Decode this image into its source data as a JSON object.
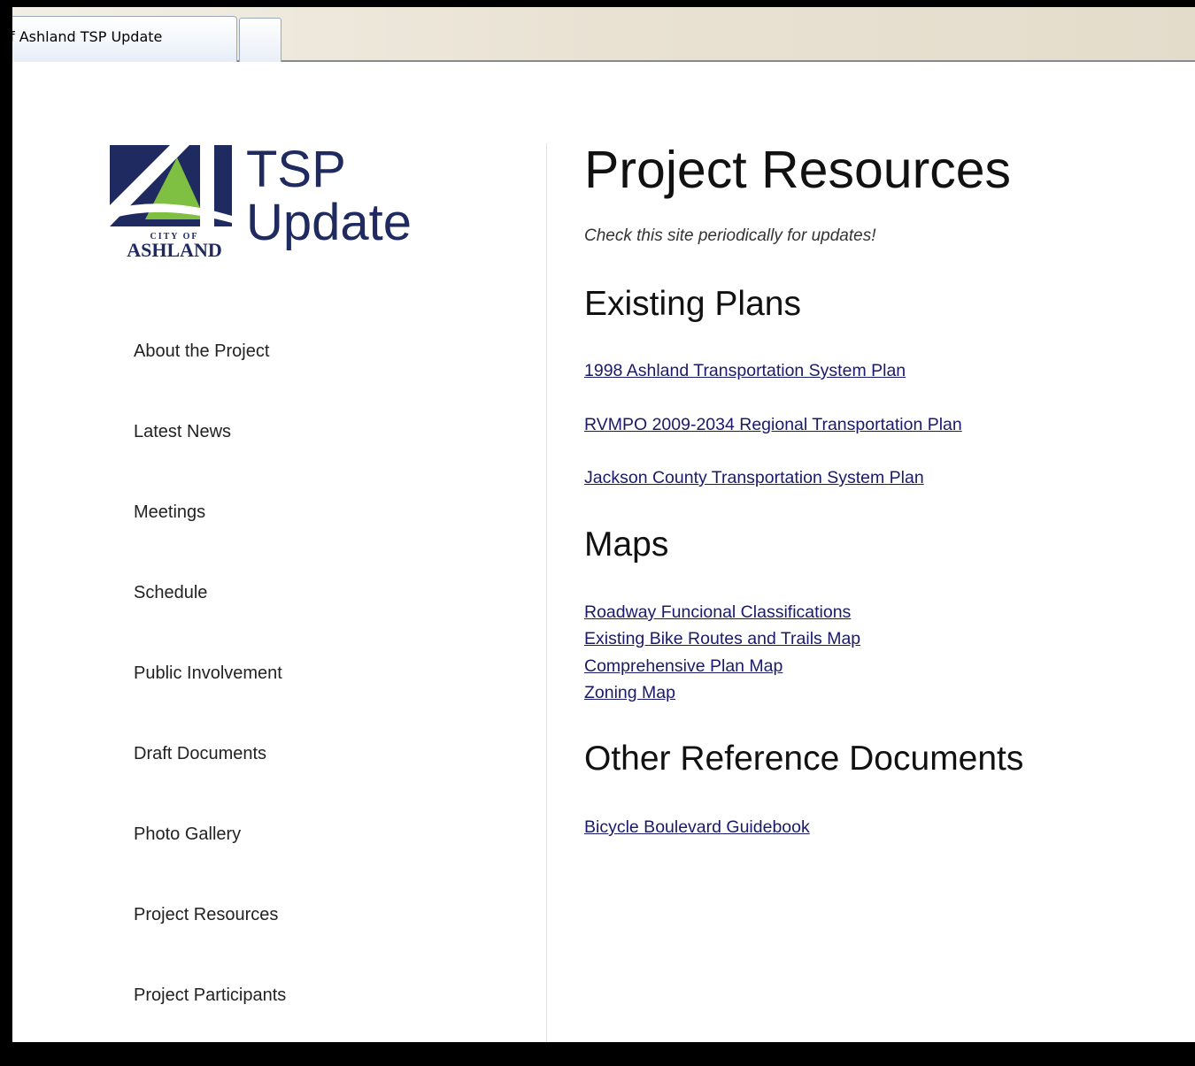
{
  "browser": {
    "tab_title": "f Ashland TSP Update"
  },
  "logo": {
    "city_of": "CITY OF",
    "city_name": "ASHLAND",
    "tsp": "TSP",
    "update": "Update",
    "colors": {
      "navy": "#1f2a60",
      "green": "#7fc042"
    }
  },
  "nav": {
    "items": [
      "About the Project",
      "Latest News",
      "Meetings",
      "Schedule",
      "Public Involvement",
      "Draft Documents",
      "Photo Gallery",
      "Project Resources",
      "Project Participants"
    ]
  },
  "main": {
    "title": "Project Resources",
    "tagline": "Check this site periodically for updates!",
    "sections": [
      {
        "heading": "Existing Plans",
        "links": [
          "1998 Ashland Transportation System Plan",
          "RVMPO 2009-2034 Regional Transportation Plan",
          "Jackson County Transportation System Plan"
        ]
      },
      {
        "heading": "Maps",
        "links": [
          "Roadway Funcional Classifications",
          "Existing Bike Routes and Trails Map",
          "Comprehensive Plan Map",
          "Zoning Map"
        ]
      },
      {
        "heading": "Other Reference Documents",
        "links": [
          "Bicycle Boulevard Guidebook"
        ]
      }
    ]
  }
}
